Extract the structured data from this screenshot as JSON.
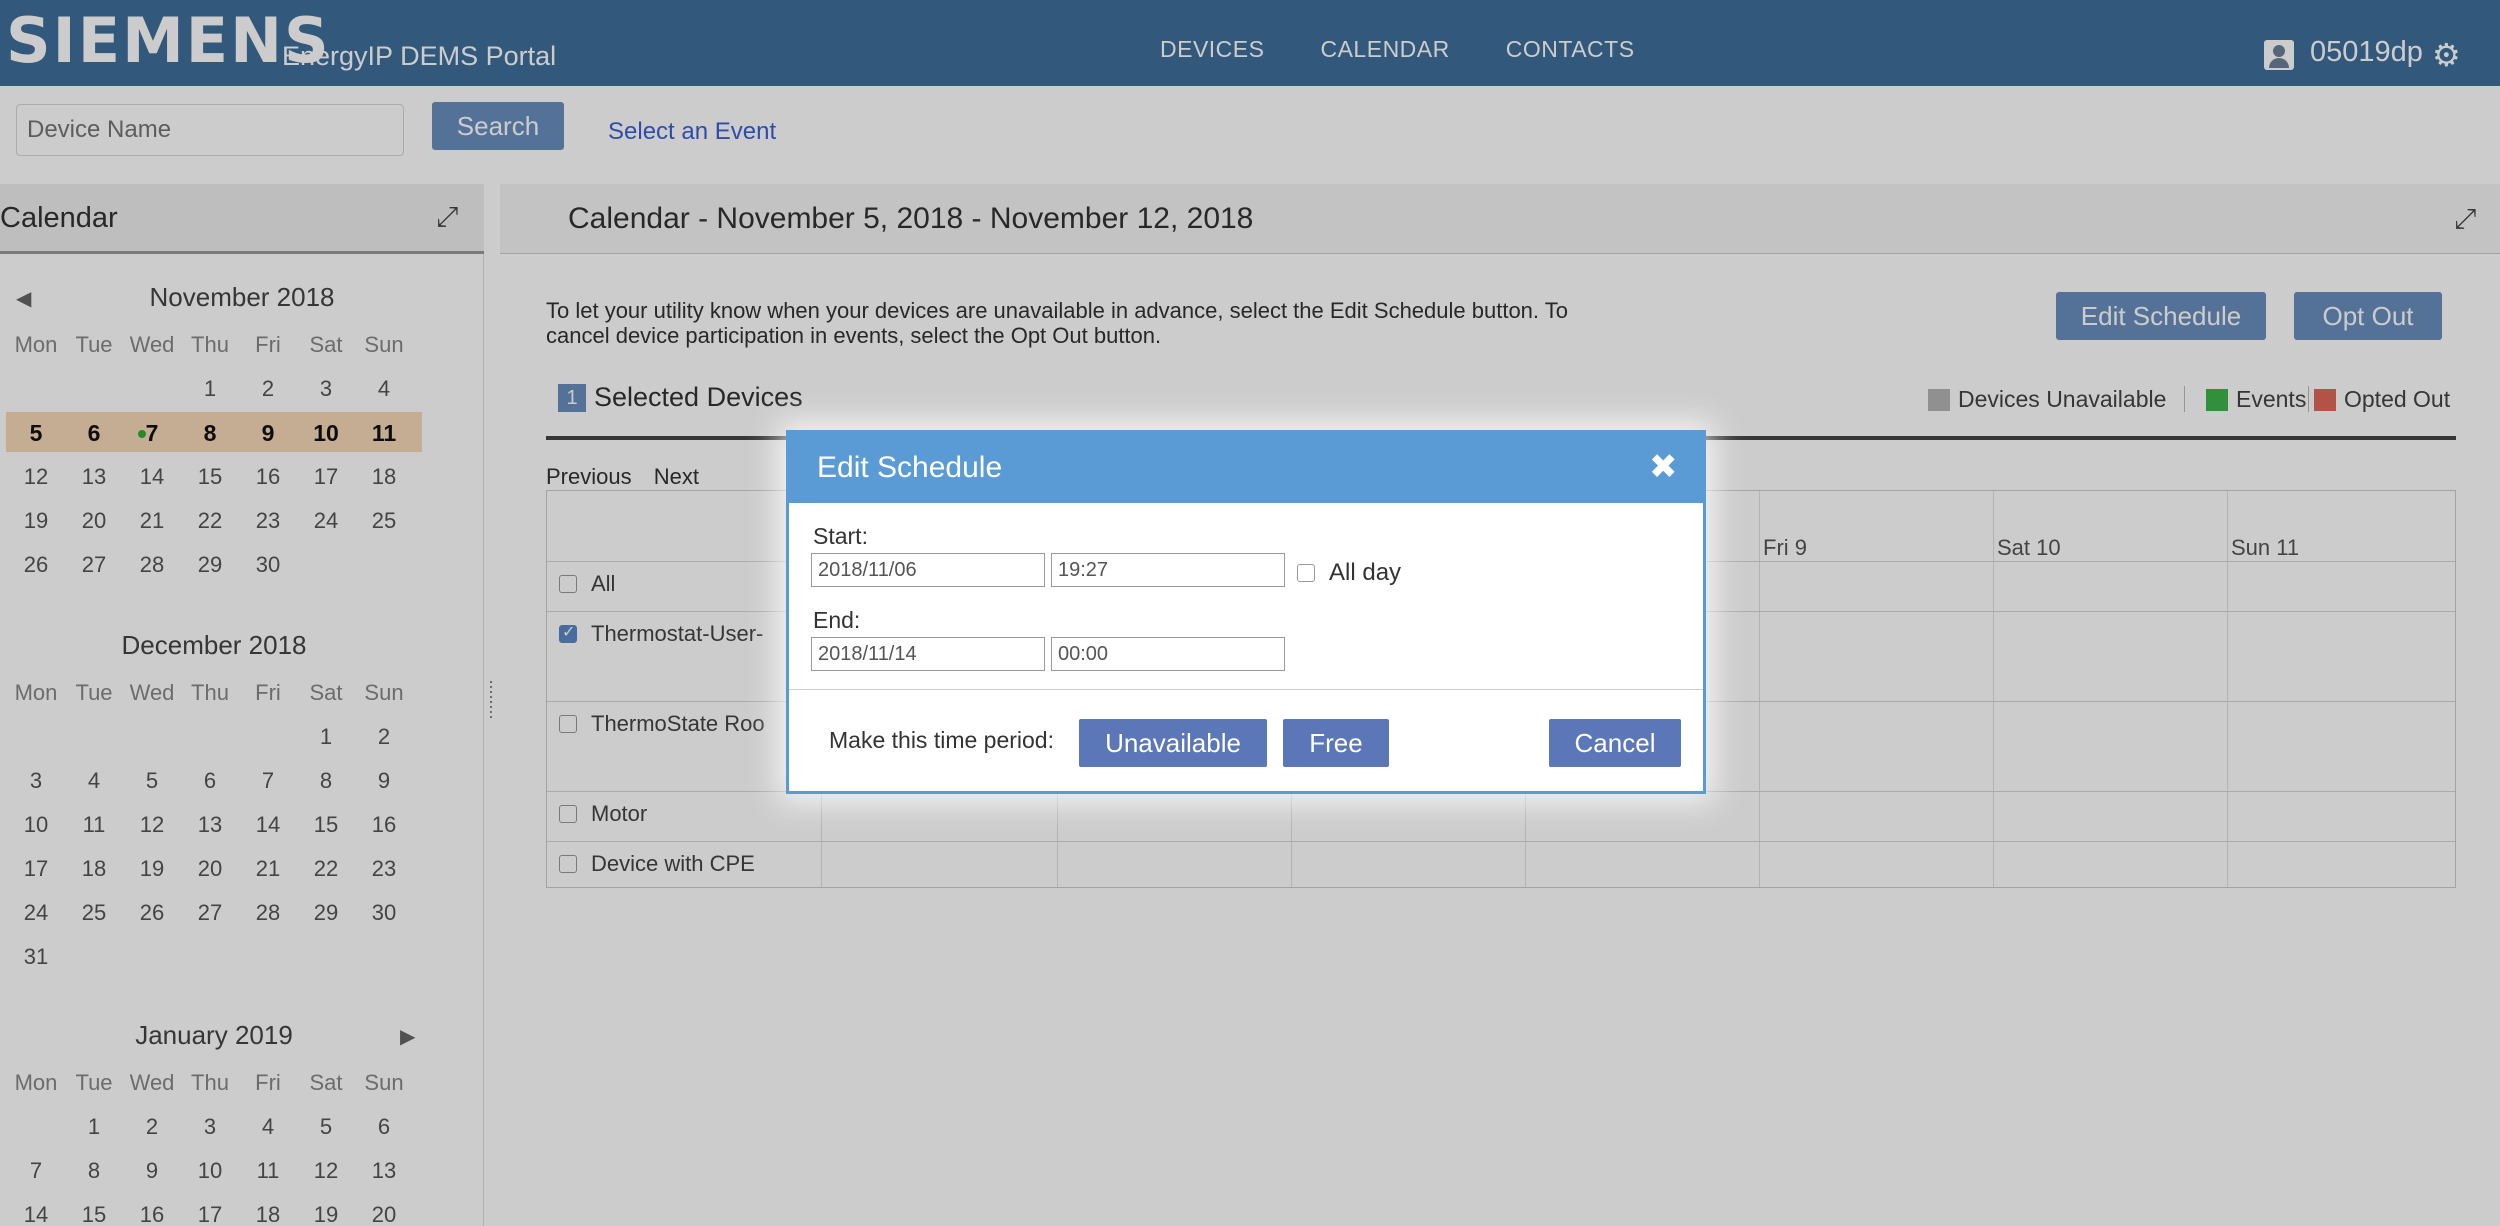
{
  "header": {
    "brand": "SIEMENS",
    "portal_name": "EnergyIP DEMS Portal",
    "nav": [
      "DEVICES",
      "CALENDAR",
      "CONTACTS"
    ],
    "username": "05019dp",
    "accent_color": "#3f6e9c"
  },
  "search": {
    "placeholder": "Device Name",
    "button_label": "Search",
    "select_event_link": "Select an Event"
  },
  "sidebar": {
    "title": "Calendar",
    "weekdays": [
      "Mon",
      "Tue",
      "Wed",
      "Thu",
      "Fri",
      "Sat",
      "Sun"
    ],
    "months": [
      {
        "title": "November 2018",
        "weeks": [
          [
            "",
            "",
            "",
            "1",
            "2",
            "3",
            "4"
          ],
          [
            "5",
            "6",
            "7",
            "8",
            "9",
            "10",
            "11"
          ],
          [
            "12",
            "13",
            "14",
            "15",
            "16",
            "17",
            "18"
          ],
          [
            "19",
            "20",
            "21",
            "22",
            "23",
            "24",
            "25"
          ],
          [
            "26",
            "27",
            "28",
            "29",
            "30",
            "",
            ""
          ]
        ],
        "highlight_week": 1
      },
      {
        "title": "December 2018",
        "weeks": [
          [
            "",
            "",
            "",
            "",
            "",
            "1",
            "2"
          ],
          [
            "3",
            "4",
            "5",
            "6",
            "7",
            "8",
            "9"
          ],
          [
            "10",
            "11",
            "12",
            "13",
            "14",
            "15",
            "16"
          ],
          [
            "17",
            "18",
            "19",
            "20",
            "21",
            "22",
            "23"
          ],
          [
            "24",
            "25",
            "26",
            "27",
            "28",
            "29",
            "30"
          ],
          [
            "31",
            "",
            "",
            "",
            "",
            "",
            ""
          ]
        ]
      },
      {
        "title": "January 2019",
        "weeks": [
          [
            "",
            "1",
            "2",
            "3",
            "4",
            "5",
            "6"
          ],
          [
            "7",
            "8",
            "9",
            "10",
            "11",
            "12",
            "13"
          ],
          [
            "14",
            "15",
            "16",
            "17",
            "18",
            "19",
            "20"
          ]
        ]
      }
    ]
  },
  "main": {
    "title": "Calendar - November 5, 2018 - November 12, 2018",
    "description": "To let your utility know when your devices are unavailable in advance, select the Edit Schedule button. To cancel device participation in events, select the Opt Out button.",
    "edit_schedule_label": "Edit Schedule",
    "opt_out_label": "Opt Out",
    "selected_count": "1",
    "selected_label": "Selected Devices",
    "legend": [
      {
        "label": "Devices Unavailable",
        "color": "#b5b5b5"
      },
      {
        "label": "Events",
        "color": "#3cb54a"
      },
      {
        "label": "Opted Out",
        "color": "#e0685a"
      }
    ],
    "pager": {
      "previous": "Previous",
      "next": "Next"
    },
    "columns": [
      "Fri 9",
      "Sat 10",
      "Sun 11"
    ],
    "devices": [
      {
        "name": "All",
        "checked": false
      },
      {
        "name": "Thermostat-User-",
        "checked": true
      },
      {
        "name": "ThermoState Roo",
        "checked": false
      },
      {
        "name": "Motor",
        "checked": false
      },
      {
        "name": "Device with CPE",
        "checked": false
      }
    ]
  },
  "modal": {
    "title": "Edit Schedule",
    "start_label": "Start:",
    "start_date": "2018/11/06",
    "start_time": "19:27",
    "all_day_label": "All day",
    "end_label": "End:",
    "end_date": "2018/11/14",
    "end_time": "00:00",
    "period_label": "Make this time period:",
    "unavailable_label": "Unavailable",
    "free_label": "Free",
    "cancel_label": "Cancel"
  }
}
